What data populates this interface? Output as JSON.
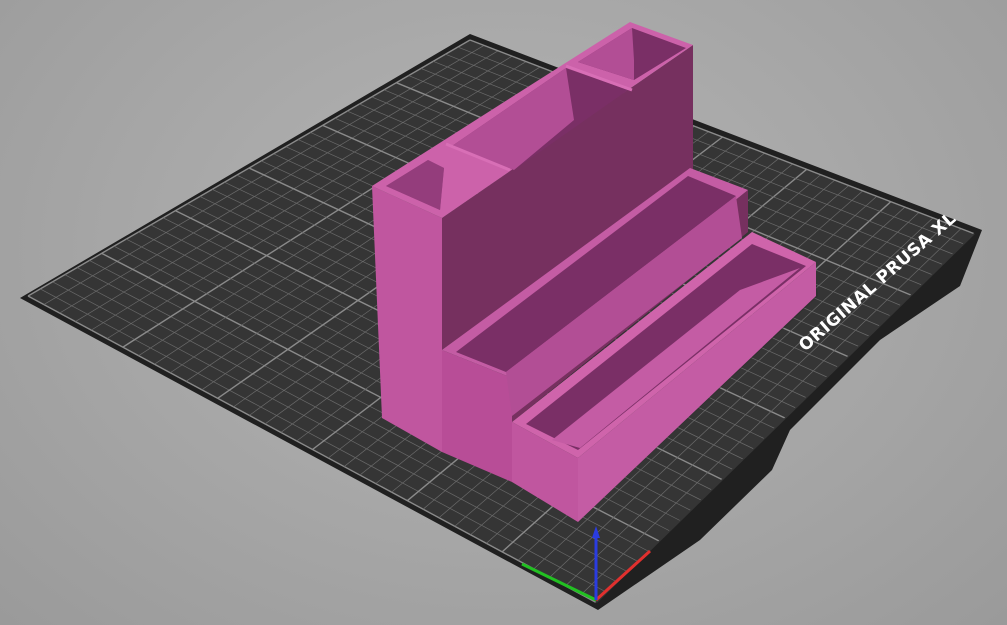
{
  "app": "3D slicer viewport",
  "scene": {
    "background_color": "#a8a8a8",
    "bed": {
      "label": "ORIGINAL PRUSA XL",
      "surface_color": "#343434",
      "edge_color": "#1c1c1c",
      "grid_color": "#6a6a6a",
      "major_grid_color": "#8a8a8a"
    },
    "object": {
      "name": "desk-organizer",
      "color": "#c0569f",
      "shade_color": "#7a2f68"
    },
    "axes": {
      "x_color": "#e0302e",
      "y_color": "#22c022",
      "z_color": "#2a3ce0"
    }
  }
}
